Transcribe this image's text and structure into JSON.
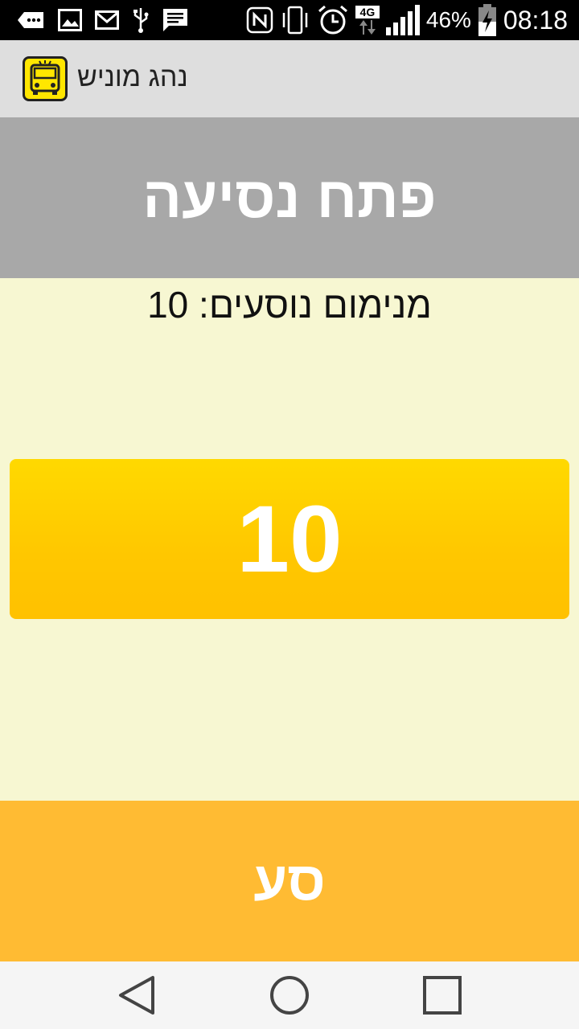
{
  "status_bar": {
    "battery_percent": "46%",
    "network": "4G",
    "time": "08:18",
    "icons": [
      "more-icon",
      "image-icon",
      "gmail-icon",
      "usb-icon",
      "message-icon",
      "nfc-icon",
      "vibrate-icon",
      "alarm-icon",
      "network-4g-icon",
      "signal-icon",
      "battery-charging-icon"
    ]
  },
  "action_bar": {
    "title": "נהג מוניש",
    "app_icon": "bus-icon"
  },
  "main": {
    "open_trip_label": "פתח נסיעה",
    "min_passengers_text": "מנימום נוסעים: 10",
    "counter_value": "10",
    "go_button_label": "סע"
  },
  "nav_bar": {
    "buttons": [
      "back-icon",
      "home-icon",
      "recents-icon"
    ]
  },
  "colors": {
    "status_bar": "#000000",
    "action_bar": "#dedede",
    "open_trip_bg": "#a8a8a8",
    "background": "#f7f7d2",
    "counter_gradient_top": "#ffd900",
    "counter_gradient_bottom": "#ffc100",
    "go_button_bg": "#ffbb33"
  }
}
